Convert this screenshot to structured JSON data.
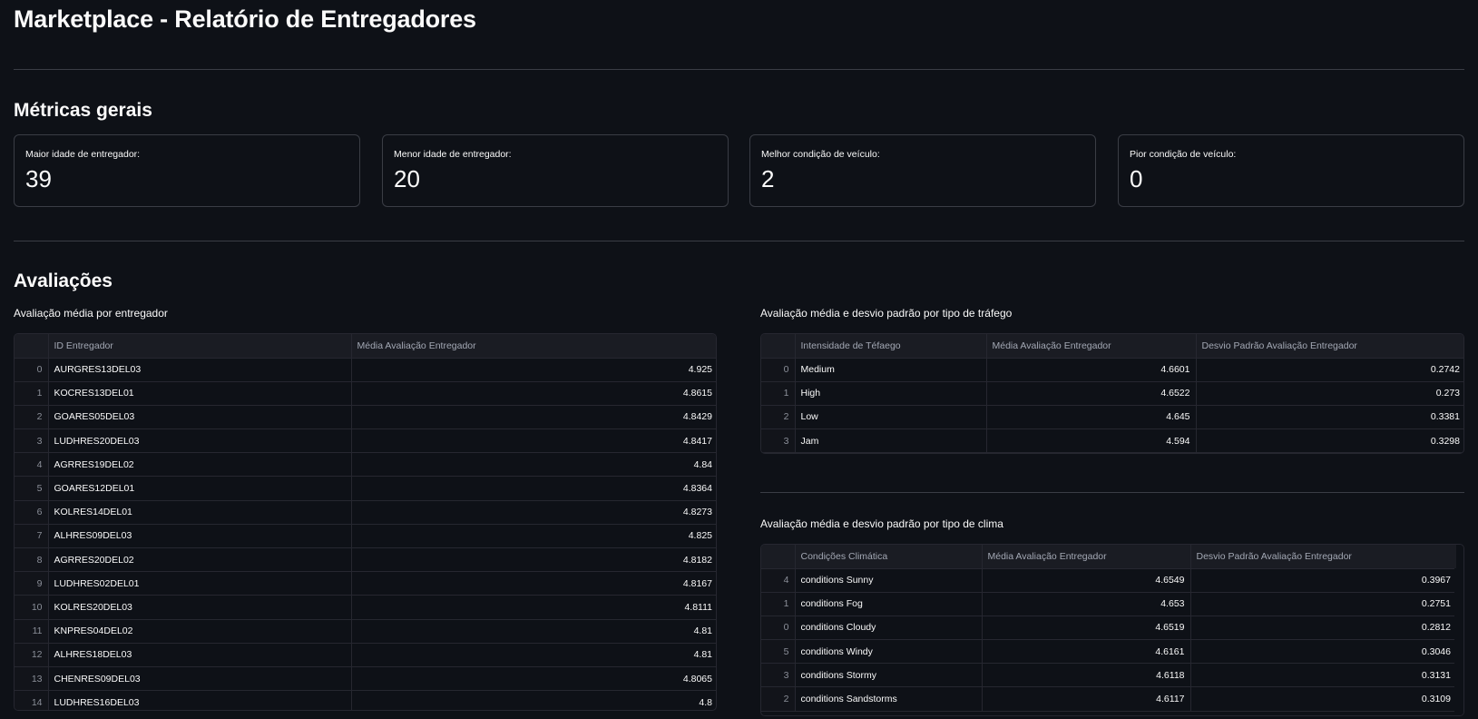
{
  "page": {
    "title": "Marketplace - Relatório de Entregadores"
  },
  "metrics": {
    "section_title": "Métricas gerais",
    "items": [
      {
        "label": "Maior idade de entregador:",
        "value": "39"
      },
      {
        "label": "Menor idade de entregador:",
        "value": "20"
      },
      {
        "label": "Melhor condição de veículo:",
        "value": "2"
      },
      {
        "label": "Pior condição de veículo:",
        "value": "0"
      }
    ]
  },
  "ratings": {
    "section_title": "Avaliações",
    "by_driver": {
      "caption": "Avaliação média por entregador",
      "columns": [
        "",
        "ID Entregador",
        "Média Avaliação Entregador"
      ],
      "rows": [
        [
          "0",
          "AURGRES13DEL03",
          "4.925"
        ],
        [
          "1",
          "KOCRES13DEL01",
          "4.8615"
        ],
        [
          "2",
          "GOARES05DEL03",
          "4.8429"
        ],
        [
          "3",
          "LUDHRES20DEL03",
          "4.8417"
        ],
        [
          "4",
          "AGRRES19DEL02",
          "4.84"
        ],
        [
          "5",
          "GOARES12DEL01",
          "4.8364"
        ],
        [
          "6",
          "KOLRES14DEL01",
          "4.8273"
        ],
        [
          "7",
          "ALHRES09DEL03",
          "4.825"
        ],
        [
          "8",
          "AGRRES20DEL02",
          "4.8182"
        ],
        [
          "9",
          "LUDHRES02DEL01",
          "4.8167"
        ],
        [
          "10",
          "KOLRES20DEL03",
          "4.8111"
        ],
        [
          "11",
          "KNPRES04DEL02",
          "4.81"
        ],
        [
          "12",
          "ALHRES18DEL03",
          "4.81"
        ],
        [
          "13",
          "CHENRES09DEL03",
          "4.8065"
        ],
        [
          "14",
          "LUDHRES16DEL03",
          "4.8"
        ]
      ]
    },
    "by_traffic": {
      "caption": "Avaliação média e desvio padrão por tipo de tráfego",
      "columns": [
        "",
        "Intensidade de Téfaego",
        "Média Avaliação Entregador",
        "Desvio Padrão Avaliação Entregador"
      ],
      "rows": [
        [
          "0",
          "Medium",
          "4.6601",
          "0.2742"
        ],
        [
          "1",
          "High",
          "4.6522",
          "0.273"
        ],
        [
          "2",
          "Low",
          "4.645",
          "0.3381"
        ],
        [
          "3",
          "Jam",
          "4.594",
          "0.3298"
        ]
      ]
    },
    "by_weather": {
      "caption": "Avaliação média e desvio padrão por tipo de clima",
      "columns": [
        "",
        "Condições Climática",
        "Média Avaliação Entregador",
        "Desvio Padrão Avaliação Entregador"
      ],
      "rows": [
        [
          "4",
          "conditions Sunny",
          "4.6549",
          "0.3967"
        ],
        [
          "1",
          "conditions Fog",
          "4.653",
          "0.2751"
        ],
        [
          "0",
          "conditions Cloudy",
          "4.6519",
          "0.2812"
        ],
        [
          "5",
          "conditions Windy",
          "4.6161",
          "0.3046"
        ],
        [
          "3",
          "conditions Stormy",
          "4.6118",
          "0.3131"
        ],
        [
          "2",
          "conditions Sandstorms",
          "4.6117",
          "0.3109"
        ]
      ]
    }
  }
}
